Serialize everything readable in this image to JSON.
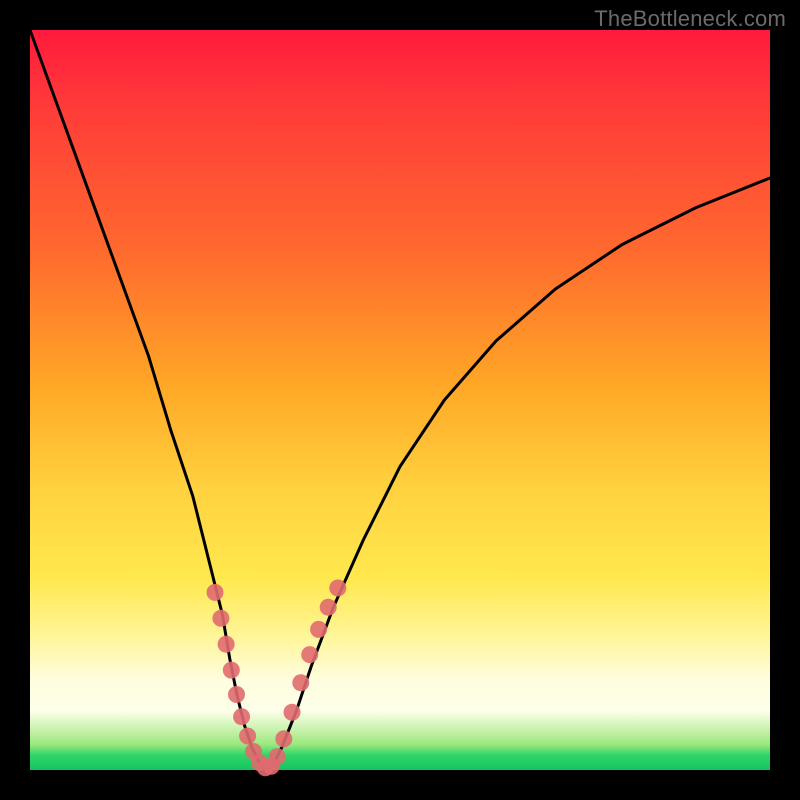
{
  "watermark": "TheBottleneck.com",
  "chart_data": {
    "type": "line",
    "title": "",
    "xlabel": "",
    "ylabel": "",
    "xlim": [
      0,
      100
    ],
    "ylim": [
      0,
      100
    ],
    "series": [
      {
        "name": "bottleneck-curve",
        "x": [
          0,
          4,
          8,
          12,
          16,
          19,
          22,
          24,
          26,
          27,
          28,
          29,
          30,
          31,
          32,
          33,
          34,
          36,
          38,
          41,
          45,
          50,
          56,
          63,
          71,
          80,
          90,
          100
        ],
        "values": [
          100,
          89,
          78,
          67,
          56,
          46,
          37,
          29,
          21,
          15,
          10,
          6,
          3,
          1,
          0,
          1,
          3,
          8,
          14,
          22,
          31,
          41,
          50,
          58,
          65,
          71,
          76,
          80
        ]
      }
    ],
    "markers": {
      "name": "highlighted-points",
      "color": "#e16a6f",
      "x": [
        25.0,
        25.8,
        26.5,
        27.2,
        27.9,
        28.6,
        29.4,
        30.2,
        31.0,
        31.8,
        32.6,
        33.4,
        34.3,
        35.4,
        36.6,
        37.8,
        39.0,
        40.3,
        41.6
      ],
      "values": [
        24.0,
        20.5,
        17.0,
        13.5,
        10.2,
        7.2,
        4.6,
        2.5,
        1.0,
        0.3,
        0.5,
        1.8,
        4.2,
        7.8,
        11.8,
        15.6,
        19.0,
        22.0,
        24.6
      ]
    }
  }
}
